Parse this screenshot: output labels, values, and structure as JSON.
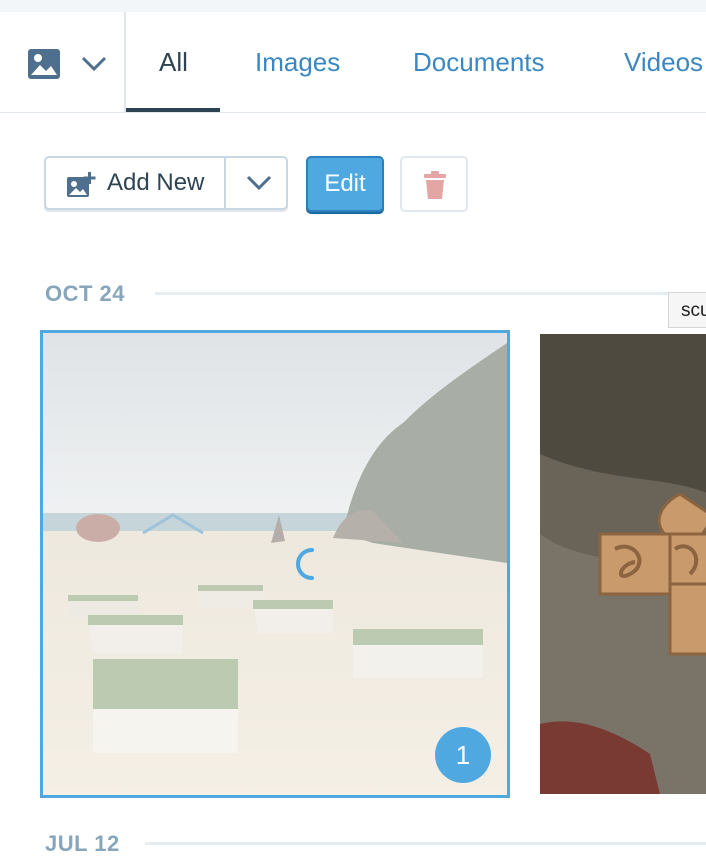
{
  "filter": {
    "type_icon": "image-icon",
    "dropdown_icon": "chevron-down-icon"
  },
  "tabs": [
    {
      "label": "All",
      "selected": true
    },
    {
      "label": "Images",
      "selected": false
    },
    {
      "label": "Documents",
      "selected": false
    },
    {
      "label": "Videos",
      "selected": false
    }
  ],
  "toolbar": {
    "add_new_label": "Add New",
    "add_new_icon": "add-image-icon",
    "dropdown_icon": "chevron-down-icon",
    "edit_label": "Edit",
    "delete_icon": "trash-icon"
  },
  "sections": [
    {
      "date": "OCT 24",
      "items": [
        {
          "kind": "image",
          "subject": "beach with puzzle-piece sculptures",
          "selected": true,
          "uploading": true,
          "selection_number": "1"
        },
        {
          "kind": "image",
          "subject": "wooden knot sculpture on rocks",
          "selected": false
        }
      ]
    },
    {
      "date": "JUL 12",
      "items": []
    }
  ],
  "tooltip": {
    "text": "scu"
  },
  "colors": {
    "accent": "#4fa8e0",
    "link": "#3a87c1",
    "text_dark": "#2e4453",
    "muted": "#87a6bc",
    "danger": "#e4a5a5"
  }
}
